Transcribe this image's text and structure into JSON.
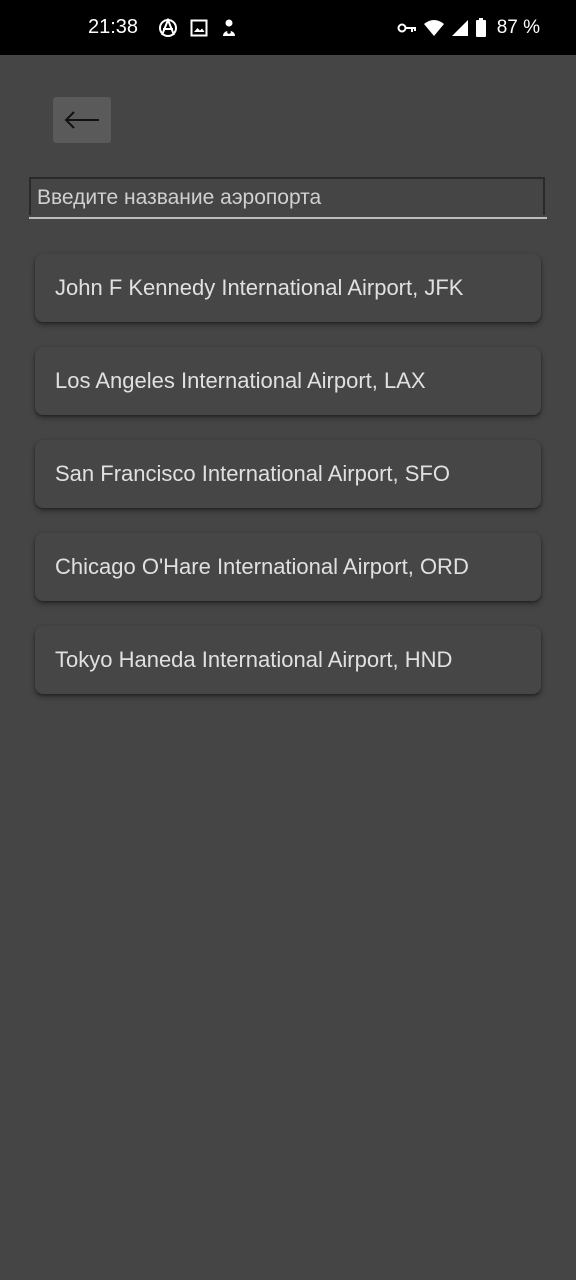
{
  "status_bar": {
    "time": "21:38",
    "left_icons": [
      "anarchy-icon",
      "image-icon",
      "notification-app-icon"
    ],
    "right_icons": [
      "vpn-key-icon",
      "wifi-icon",
      "signal-icon",
      "battery-icon"
    ],
    "battery_percent": "87 %"
  },
  "header": {
    "back_icon": "arrow-left-icon"
  },
  "search": {
    "placeholder": "Введите название аэропорта",
    "value": ""
  },
  "airports": [
    {
      "label": "John F Kennedy International Airport, JFK"
    },
    {
      "label": "Los Angeles International Airport, LAX"
    },
    {
      "label": "San Francisco International Airport, SFO"
    },
    {
      "label": "Chicago O'Hare International Airport, ORD"
    },
    {
      "label": "Tokyo Haneda International Airport, HND"
    }
  ],
  "colors": {
    "background": "#454545",
    "status_bar": "#000000",
    "card": "#464646",
    "text": "#e0e0e0",
    "back_button": "#5a5a5a"
  }
}
